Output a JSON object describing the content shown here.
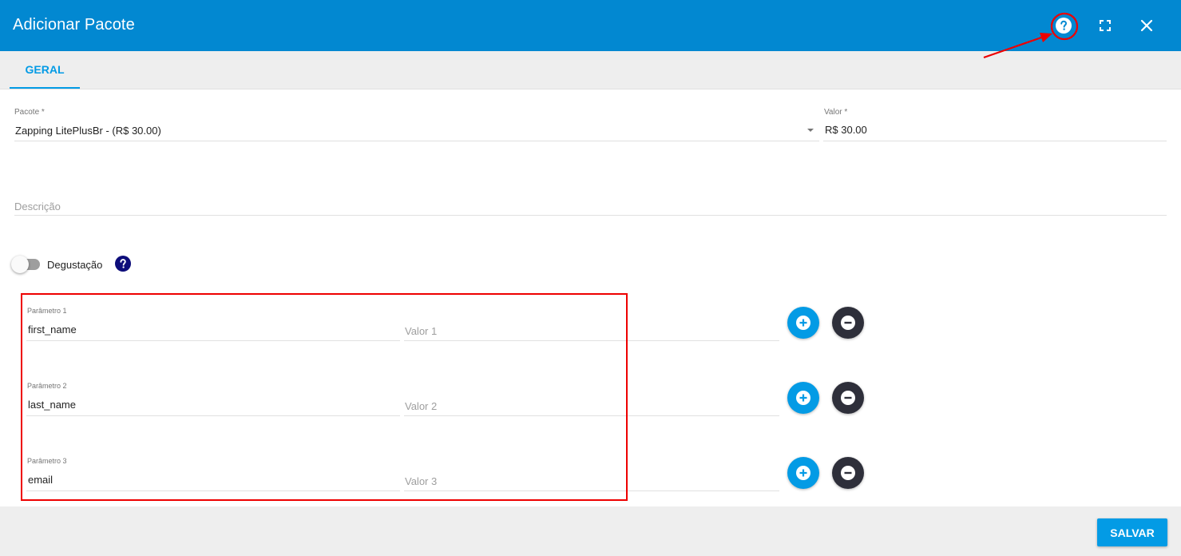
{
  "header": {
    "title": "Adicionar Pacote",
    "background": "#0288d1",
    "icons": [
      "help-icon",
      "fullscreen-icon",
      "close-icon"
    ]
  },
  "tabs": [
    {
      "label": "GERAL",
      "active": true
    }
  ],
  "form": {
    "pacote": {
      "label": "Pacote *",
      "value": "Zapping LitePlusBr - (R$ 30.00)"
    },
    "valor": {
      "label": "Valor *",
      "value": "R$ 30.00"
    },
    "descricao": {
      "placeholder": "Descrição"
    },
    "degustacao": {
      "label": "Degustação",
      "checked": false
    },
    "parameters": [
      {
        "label": "Parâmetro 1",
        "value": "first_name",
        "value_placeholder": "Valor 1"
      },
      {
        "label": "Parâmetro 2",
        "value": "last_name",
        "value_placeholder": "Valor 2"
      },
      {
        "label": "Parâmetro 3",
        "value": "email",
        "value_placeholder": "Valor 3"
      }
    ]
  },
  "footer": {
    "save_label": "SALVAR"
  },
  "colors": {
    "accent": "#039be5",
    "dark_button": "#2e2f3a",
    "annotation": "#e00000"
  }
}
